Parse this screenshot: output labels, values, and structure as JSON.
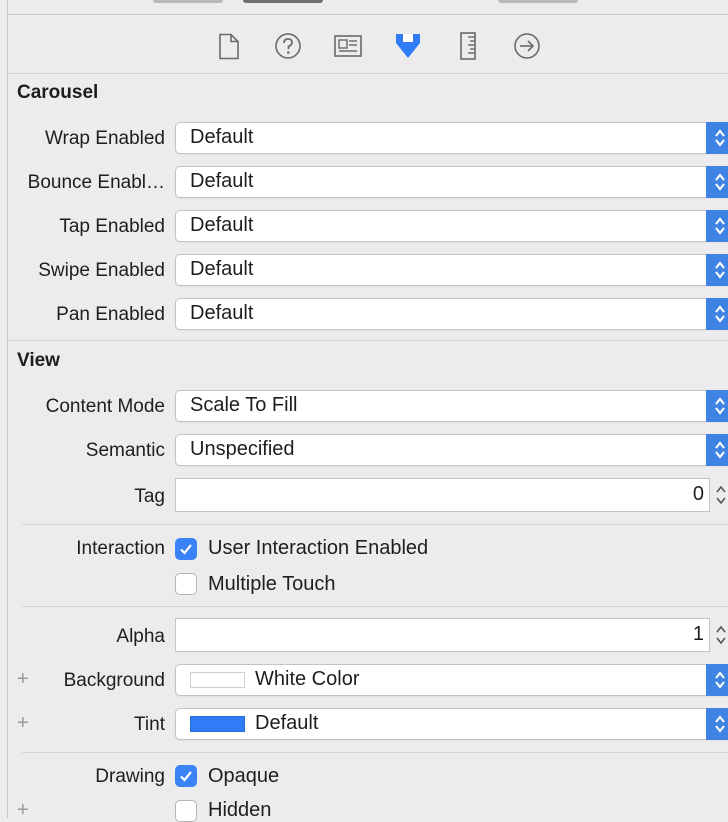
{
  "toolbar": {
    "icons": [
      "file-icon",
      "help-icon",
      "identity-icon",
      "attributes-icon",
      "size-icon",
      "connections-icon"
    ],
    "accent": "#2f7cf6"
  },
  "carousel": {
    "title": "Carousel",
    "rows": [
      {
        "label": "Wrap Enabled",
        "value": "Default"
      },
      {
        "label": "Bounce Enabl…",
        "value": "Default"
      },
      {
        "label": "Tap Enabled",
        "value": "Default"
      },
      {
        "label": "Swipe Enabled",
        "value": "Default"
      },
      {
        "label": "Pan Enabled",
        "value": "Default"
      }
    ]
  },
  "view": {
    "title": "View",
    "content_mode": {
      "label": "Content Mode",
      "value": "Scale To Fill"
    },
    "semantic": {
      "label": "Semantic",
      "value": "Unspecified"
    },
    "tag": {
      "label": "Tag",
      "value": "0"
    },
    "interaction": {
      "label": "Interaction",
      "options": [
        {
          "label": "User Interaction Enabled",
          "checked": true
        },
        {
          "label": "Multiple Touch",
          "checked": false
        }
      ]
    },
    "alpha": {
      "label": "Alpha",
      "value": "1"
    },
    "background": {
      "label": "Background",
      "value": "White Color",
      "swatch": "#ffffff"
    },
    "tint": {
      "label": "Tint",
      "value": "Default",
      "swatch": "#2f7cf6"
    },
    "drawing": {
      "label": "Drawing",
      "options": [
        {
          "label": "Opaque",
          "checked": true
        },
        {
          "label": "Hidden",
          "checked": false
        }
      ]
    },
    "plus_symbol": "+"
  },
  "colors": {
    "accent": "#3a82f7",
    "panel": "#ececec"
  }
}
